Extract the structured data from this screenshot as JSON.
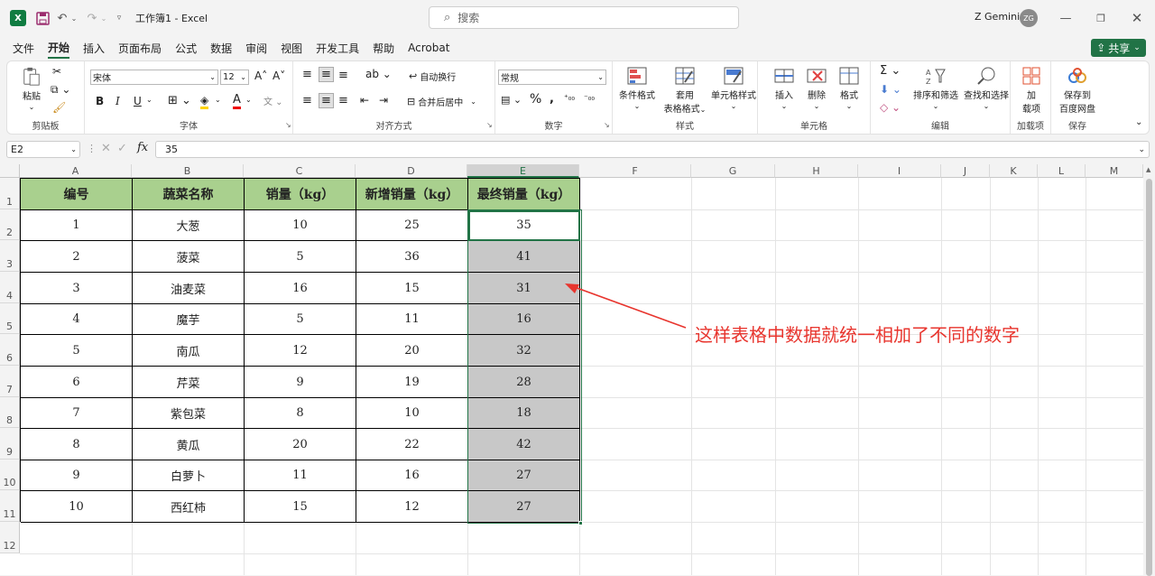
{
  "app": {
    "doc_title": "工作簿1 - Excel",
    "search_placeholder": "搜索",
    "user_name": "Z Gemini",
    "user_initials": "ZG"
  },
  "menu": [
    "文件",
    "开始",
    "插入",
    "页面布局",
    "公式",
    "数据",
    "审阅",
    "视图",
    "开发工具",
    "帮助",
    "Acrobat"
  ],
  "share_label": "共享",
  "ribbon": {
    "paste": "粘贴",
    "clipboard_label": "剪贴板",
    "font_name": "宋体",
    "font_size": "12",
    "font_label": "字体",
    "bold": "B",
    "italic": "I",
    "underline": "U",
    "wrap_text": "自动换行",
    "merge_center": "合并后居中",
    "align_label": "对齐方式",
    "number_format": "常规",
    "number_label": "数字",
    "cond_format": "条件格式",
    "table_format_1": "套用",
    "table_format_2": "表格格式",
    "cell_styles": "单元格样式",
    "styles_label": "样式",
    "insert": "插入",
    "delete": "删除",
    "format": "格式",
    "cells_label": "单元格",
    "sort_filter": "排序和筛选",
    "find_select": "查找和选择",
    "edit_label": "编辑",
    "addins_1": "加",
    "addins_2": "载项",
    "addins_label": "加载项",
    "save_baidu_1": "保存到",
    "save_baidu_2": "百度网盘",
    "save_label": "保存"
  },
  "formula_bar": {
    "name_box": "E2",
    "fx": "fx",
    "value": "35"
  },
  "columns": [
    "A",
    "B",
    "C",
    "D",
    "E",
    "F",
    "G",
    "H",
    "I",
    "J",
    "K",
    "L",
    "M"
  ],
  "rows": [
    "1",
    "2",
    "3",
    "4",
    "5",
    "6",
    "7",
    "8",
    "9",
    "10",
    "11",
    "12"
  ],
  "table": {
    "headers": [
      "编号",
      "蔬菜名称",
      "销量（kg）",
      "新增销量（kg）",
      "最终销量（kg）"
    ],
    "rows": [
      [
        "1",
        "大葱",
        "10",
        "25",
        "35"
      ],
      [
        "2",
        "菠菜",
        "5",
        "36",
        "41"
      ],
      [
        "3",
        "油麦菜",
        "16",
        "15",
        "31"
      ],
      [
        "4",
        "魔芋",
        "5",
        "11",
        "16"
      ],
      [
        "5",
        "南瓜",
        "12",
        "20",
        "32"
      ],
      [
        "6",
        "芹菜",
        "9",
        "19",
        "28"
      ],
      [
        "7",
        "紫包菜",
        "8",
        "10",
        "18"
      ],
      [
        "8",
        "黄瓜",
        "20",
        "22",
        "42"
      ],
      [
        "9",
        "白萝卜",
        "11",
        "16",
        "27"
      ],
      [
        "10",
        "西红柿",
        "15",
        "12",
        "27"
      ]
    ]
  },
  "annotation": "这样表格中数据就统一相加了不同的数字",
  "colors": {
    "accent": "#217346",
    "header_fill": "#a9d08e",
    "selection_fill": "#c8c8c8",
    "annotation": "#e8352e"
  }
}
